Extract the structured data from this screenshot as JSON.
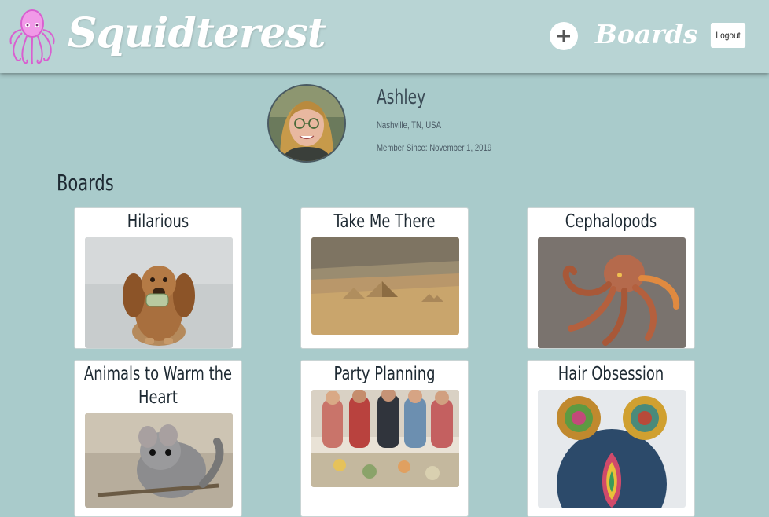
{
  "app": {
    "brand": "Squidterest"
  },
  "nav": {
    "boards_label": "Boards",
    "logout_label": "Logout",
    "add_icon": "plus-icon"
  },
  "profile": {
    "name": "Ashley",
    "location": "Nashville, TN, USA",
    "member_since": "Member Since: November 1, 2019"
  },
  "section": {
    "title": "Boards"
  },
  "boards": [
    {
      "title": "Hilarious",
      "image": "dachshund-with-money"
    },
    {
      "title": "Take Me There",
      "image": "pyramids-aerial"
    },
    {
      "title": "Cephalopods",
      "image": "octopus"
    },
    {
      "title": "Animals to Warm the Heart",
      "image": "chinchilla"
    },
    {
      "title": "Party Planning",
      "image": "party-group"
    },
    {
      "title": "Hair Obsession",
      "image": "rainbow-hair-buns"
    }
  ],
  "colors": {
    "background": "#a9cbcb",
    "navbar": "#b8d4d4",
    "logo": "#e879e0",
    "card": "#ffffff",
    "text": "#1e2a33"
  }
}
